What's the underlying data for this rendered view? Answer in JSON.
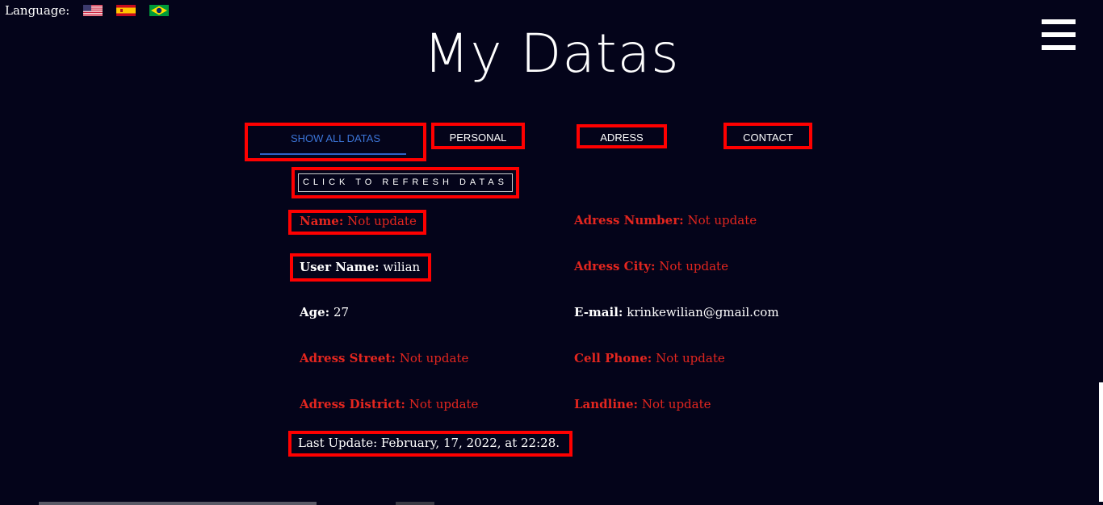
{
  "language": {
    "label": "Language:",
    "flags": [
      {
        "name": "us-flag-icon",
        "lang": "English"
      },
      {
        "name": "spain-flag-icon",
        "lang": "Español"
      },
      {
        "name": "brazil-flag-icon",
        "lang": "Português"
      }
    ]
  },
  "menu": {
    "icon": "hamburger-menu-icon"
  },
  "page": {
    "title": "My Datas"
  },
  "tabs": {
    "all": "SHOW ALL DATAS",
    "personal": "PERSONAL",
    "adress": "ADRESS",
    "contact": "CONTACT",
    "active": "all"
  },
  "refresh": {
    "label": "CLICK TO REFRESH DATAS"
  },
  "fields": {
    "name": {
      "label": "Name:",
      "value": "Not update"
    },
    "user_name": {
      "label": "User Name:",
      "value": "wilian"
    },
    "age": {
      "label": "Age:",
      "value": "27"
    },
    "adress_street": {
      "label": "Adress Street:",
      "value": "Not update"
    },
    "adress_district": {
      "label": "Adress District:",
      "value": "Not update"
    },
    "adress_number": {
      "label": "Adress Number:",
      "value": "Not update"
    },
    "adress_city": {
      "label": "Adress City:",
      "value": "Not update"
    },
    "email": {
      "label": "E-mail:",
      "value": "krinkewilian@gmail.com"
    },
    "cell_phone": {
      "label": "Cell Phone:",
      "value": "Not update"
    },
    "landline": {
      "label": "Landline:",
      "value": "Not update"
    }
  },
  "last_update": {
    "text": "Last Update: February, 17, 2022, at 22:28."
  },
  "colors": {
    "background": "#04041a",
    "highlight_border": "#ff0000",
    "missing_value": "#e3261f",
    "active_tab": "#3b74d6",
    "text": "#ffffff"
  }
}
